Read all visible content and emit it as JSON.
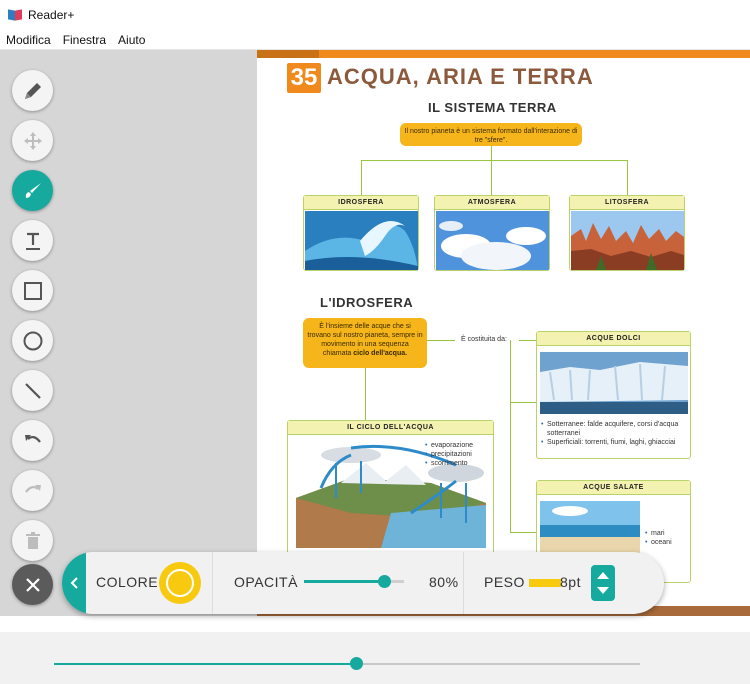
{
  "app": {
    "title": "Reader+",
    "accent": "#16a99e"
  },
  "menu": {
    "items": [
      "Modifica",
      "Finestra",
      "Aiuto"
    ]
  },
  "page": {
    "number": "35",
    "title": "ACQUA, ARIA E TERRA",
    "section1": {
      "title": "IL SISTEMA TERRA",
      "bubble": "Il nostro pianeta è un sistema formato dall'interazione di tre \"sfere\".",
      "spheres": [
        "IDROSFERA",
        "ATMOSFERA",
        "LITOSFERA"
      ]
    },
    "section2": {
      "title": "L'IDROSFERA",
      "bubble_text": "È l'insieme delle acque che si trovano sul nostro pianeta, sempre in movimento in una sequenza chiamata",
      "bubble_bold": "ciclo dell'acqua.",
      "composed_label": "È costituita da:",
      "ciclo": {
        "title": "IL CICLO DELL'ACQUA",
        "items": [
          "evaporazione",
          "precipitazioni",
          "scorrimento"
        ]
      },
      "dolci": {
        "title": "ACQUE DOLCI",
        "items": [
          "Sotterranee: falde acquifere, corsi d'acqua sotterranei",
          "Superficiali: torrenti, fiumi, laghi, ghiacciai"
        ]
      },
      "salate": {
        "title": "ACQUE SALATE",
        "items": [
          "mari",
          "oceani"
        ]
      }
    }
  },
  "tools": [
    "pencil-tool",
    "move-tool",
    "brush-tool",
    "text-tool",
    "rectangle-tool",
    "circle-tool",
    "line-tool",
    "undo-tool",
    "redo-tool",
    "delete-tool",
    "close-tool"
  ],
  "toolbar": {
    "color_label": "COLORE",
    "color_value": "#f7c90f",
    "opacity_label": "OPACITÀ",
    "opacity_value": "80%",
    "opacity_fraction": 0.8,
    "weight_label": "PESO",
    "weight_value": "8pt"
  },
  "footer": {
    "slider_fraction": 0.516
  }
}
